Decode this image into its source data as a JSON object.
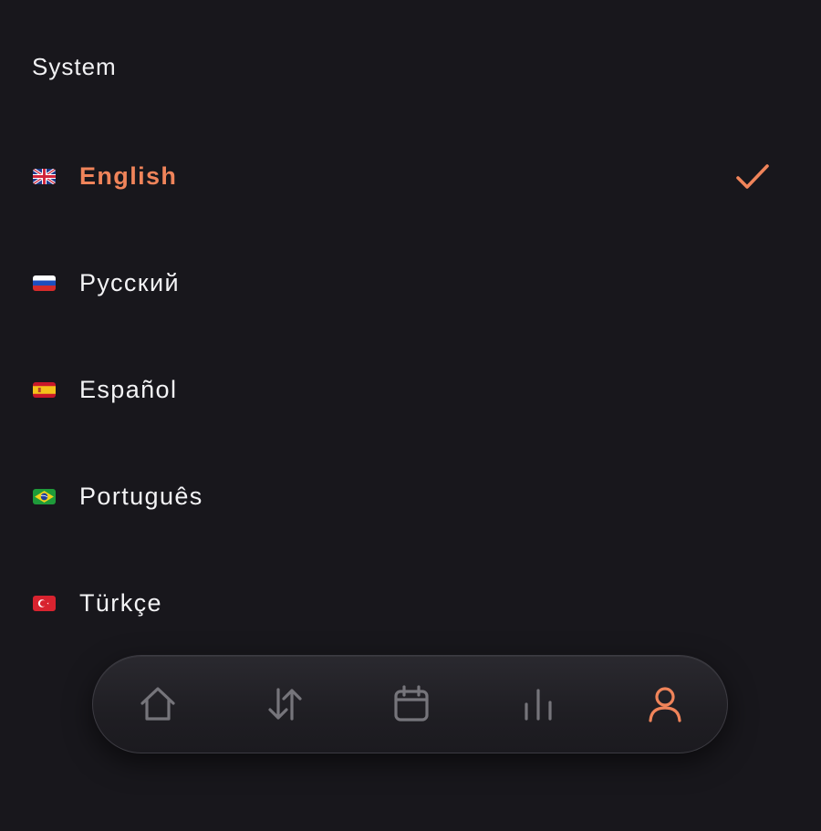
{
  "section": {
    "title": "System"
  },
  "languages": [
    {
      "label": "English",
      "flag": "uk-flag-icon",
      "selected": true
    },
    {
      "label": "Русский",
      "flag": "russia-flag-icon",
      "selected": false
    },
    {
      "label": "Español",
      "flag": "spain-flag-icon",
      "selected": false
    },
    {
      "label": "Português",
      "flag": "brazil-flag-icon",
      "selected": false
    },
    {
      "label": "Türkçe",
      "flag": "turkey-flag-icon",
      "selected": false
    }
  ],
  "selected_indicator": "checkmark-icon",
  "tabbar": {
    "items": [
      {
        "name": "home",
        "icon": "home-icon",
        "active": false
      },
      {
        "name": "transfers",
        "icon": "up-down-arrows-icon",
        "active": false
      },
      {
        "name": "calendar",
        "icon": "calendar-icon",
        "active": false
      },
      {
        "name": "stats",
        "icon": "bar-chart-icon",
        "active": false
      },
      {
        "name": "profile",
        "icon": "person-icon",
        "active": true
      }
    ]
  },
  "colors": {
    "background": "#18171c",
    "accent": "#f0845a",
    "text": "#f2f2f4",
    "icon_inactive": "#76757b"
  }
}
